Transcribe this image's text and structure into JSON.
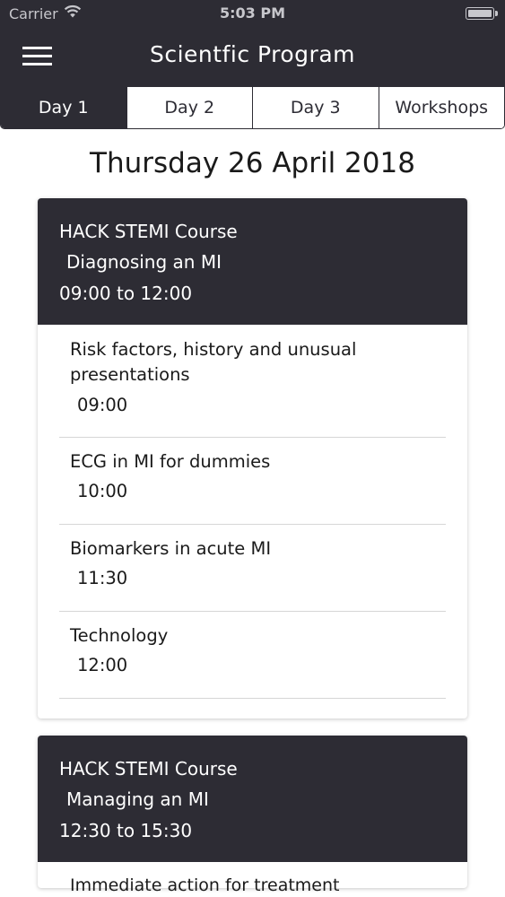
{
  "status_bar": {
    "carrier": "Carrier",
    "time": "5:03 PM"
  },
  "nav": {
    "title": "Scientfic Program",
    "menu_icon": "hamburger-menu-icon"
  },
  "tabs": [
    {
      "label": "Day 1",
      "active": true
    },
    {
      "label": "Day 2",
      "active": false
    },
    {
      "label": "Day 3",
      "active": false
    },
    {
      "label": "Workshops",
      "active": false
    }
  ],
  "date_heading": "Thursday 26 April 2018",
  "sessions": [
    {
      "title": "HACK STEMI Course",
      "subtitle": "Diagnosing an MI",
      "time": "09:00 to 12:00",
      "talks": [
        {
          "title": "Risk factors, history and unusual presentations",
          "time": "09:00"
        },
        {
          "title": "ECG in MI for dummies",
          "time": "10:00"
        },
        {
          "title": "Biomarkers in acute MI",
          "time": "11:30"
        },
        {
          "title": "Technology",
          "time": "12:00"
        }
      ]
    },
    {
      "title": "HACK STEMI Course",
      "subtitle": "Managing an MI",
      "time": "12:30 to 15:30",
      "talks": [
        {
          "title": "Immediate action for treatment",
          "time": ""
        }
      ]
    }
  ],
  "colors": {
    "header_bg": "#2d2c34",
    "active_tab_bg": "#2d2c34",
    "divider": "#d6d6d6"
  }
}
